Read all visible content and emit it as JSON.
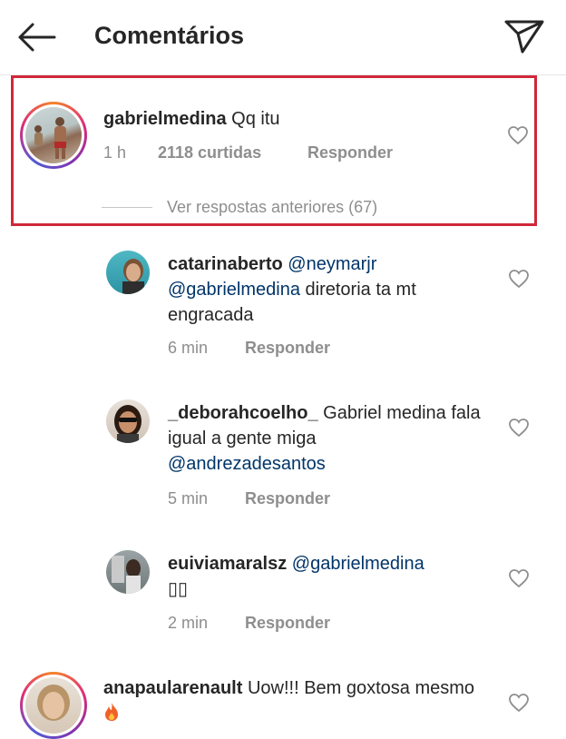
{
  "header": {
    "title": "Comentários",
    "back_icon": "back-arrow-icon",
    "send_icon": "send-icon"
  },
  "main_comment": {
    "username": "gabrielmedina",
    "text": "Qq itu",
    "time": "1 h",
    "likes": "2118 curtidas",
    "reply": "Responder",
    "view_replies": "Ver respostas anteriores (67)"
  },
  "replies": [
    {
      "username": "catarinaberto",
      "mention1": "@neymarjr",
      "mention2": "@gabrielmedina",
      "text": "diretoria ta mt engracada",
      "time": "6 min",
      "reply": "Responder"
    },
    {
      "username": "_deborahcoelho_",
      "text": "Gabriel medina fala igual a gente miga",
      "mention": "@andrezadesantos",
      "time": "5 min",
      "reply": "Responder"
    },
    {
      "username": "euiviamaralsz",
      "mention": "@gabrielmedina",
      "text": "▯▯",
      "time": "2 min",
      "reply": "Responder"
    }
  ],
  "bottom_comment": {
    "username": "anapaularenault",
    "text": "Uow!!! Bem goxtosa mesmo",
    "emoji": "fire-icon"
  },
  "colors": {
    "accent_border": "#d0283a",
    "mention": "#003569",
    "secondary": "#8e8e8e"
  }
}
